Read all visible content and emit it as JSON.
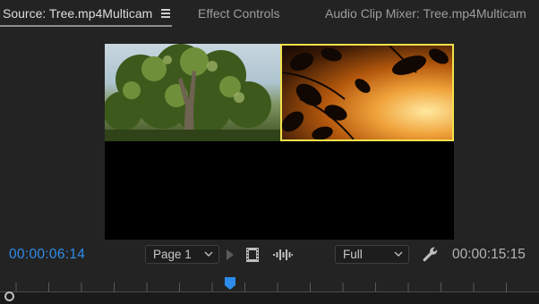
{
  "tabs": [
    {
      "label": "Source: Tree.mp4Multicam",
      "active": true
    },
    {
      "label": "Effect Controls",
      "active": false
    },
    {
      "label": "Audio Clip Mixer: Tree.mp4Multicam",
      "active": false
    }
  ],
  "panel_menu_icon": "hamburger-menu-icon",
  "video": {
    "cameras": [
      {
        "name": "camera-1",
        "selected": false
      },
      {
        "name": "camera-2",
        "selected": true
      }
    ],
    "selection_color": "#f2e24a"
  },
  "controls": {
    "current_timecode": "00:00:06:14",
    "page_select": "Page 1",
    "zoom_select": "Full",
    "duration_timecode": "00:00:15:15",
    "timecode_color": "#2d8ceb",
    "icons": [
      "play-icon",
      "export-frame-icon",
      "audio-follows-video-icon",
      "wrench-icon"
    ]
  },
  "ruler": {
    "playhead_color": "#2d8ceb"
  }
}
